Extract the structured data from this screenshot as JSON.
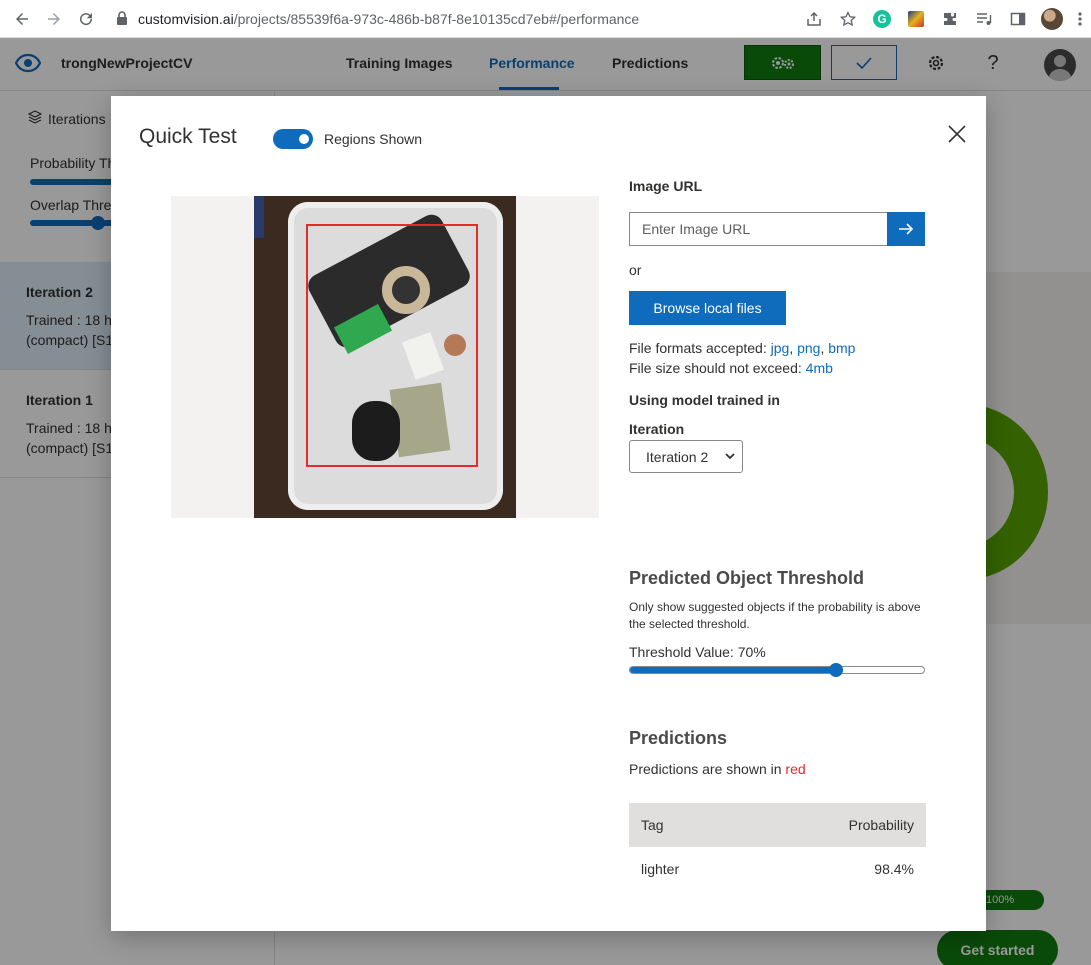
{
  "browser": {
    "url_host": "customvision.ai",
    "url_path": "/projects/85539f6a-973c-486b-b87f-8e10135cd7eb#/performance"
  },
  "header": {
    "project_name": "trongNewProjectCV",
    "tabs": [
      {
        "label": "Training Images"
      },
      {
        "label": "Performance"
      },
      {
        "label": "Predictions"
      }
    ],
    "active_tab": "Performance"
  },
  "sidebar": {
    "title": "Iterations",
    "probability_label": "Probability Th",
    "overlap_label": "Overlap Thre",
    "iterations": [
      {
        "name": "Iteration 2",
        "meta_line1": "Trained : 18 h",
        "meta_line2": "(compact) [S1"
      },
      {
        "name": "Iteration 1",
        "meta_line1": "Trained : 18 h",
        "meta_line2": "(compact) [S1"
      }
    ]
  },
  "background": {
    "pct_pill": "100%",
    "get_started": "Get started"
  },
  "modal": {
    "title": "Quick Test",
    "toggle_label": "Regions Shown",
    "toggle_on": true,
    "image_url_label": "Image URL",
    "image_url_placeholder": "Enter Image URL",
    "or_text": "or",
    "browse_label": "Browse local files",
    "formats_prefix": "File formats accepted: ",
    "formats": [
      "jpg",
      "png",
      "bmp"
    ],
    "size_prefix": "File size should not exceed: ",
    "size_value": "4mb",
    "model_heading": "Using model trained in",
    "iteration_label": "Iteration",
    "iteration_selected": "Iteration 2",
    "threshold": {
      "title": "Predicted Object Threshold",
      "description": "Only show suggested objects if the probability is above the selected threshold.",
      "value_label": "Threshold Value: 70%",
      "value": 0.7
    },
    "predictions": {
      "title": "Predictions",
      "note_prefix": "Predictions are shown in ",
      "note_color_word": "red",
      "columns": [
        "Tag",
        "Probability"
      ],
      "rows": [
        {
          "tag": "lighter",
          "probability": "98.4%"
        }
      ]
    }
  },
  "colors": {
    "accent": "#0f6cbd",
    "train_green": "#107c10",
    "box_red": "#e22b2b"
  }
}
